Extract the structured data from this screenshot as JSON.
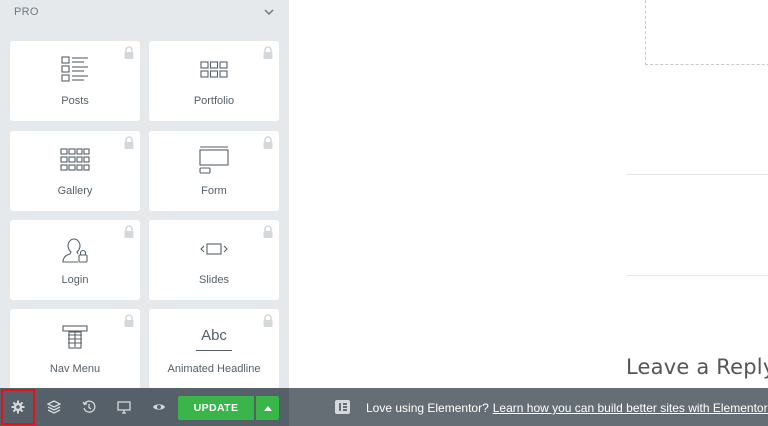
{
  "sidebar": {
    "section_title": "PRO",
    "widgets": [
      {
        "label": "Posts",
        "icon": "posts-icon"
      },
      {
        "label": "Portfolio",
        "icon": "portfolio-icon"
      },
      {
        "label": "Gallery",
        "icon": "gallery-icon"
      },
      {
        "label": "Form",
        "icon": "form-icon"
      },
      {
        "label": "Login",
        "icon": "login-icon"
      },
      {
        "label": "Slides",
        "icon": "slides-icon"
      },
      {
        "label": "Nav Menu",
        "icon": "nav-menu-icon"
      },
      {
        "label": "Animated Headline",
        "icon": "animated-headline-icon"
      }
    ],
    "animated_headline_icon_text": "Abc"
  },
  "canvas": {
    "leave_reply": "Leave a Reply"
  },
  "footer": {
    "update_label": "UPDATE",
    "buttons": [
      "gear-icon",
      "layers-icon",
      "history-icon",
      "desktop-icon",
      "eye-icon"
    ],
    "highlight_color": "#e0121d",
    "update_color": "#39b54a"
  },
  "notice": {
    "text": "Love using Elementor?",
    "link": "Learn how you can build better sites with Elementor Pro."
  }
}
